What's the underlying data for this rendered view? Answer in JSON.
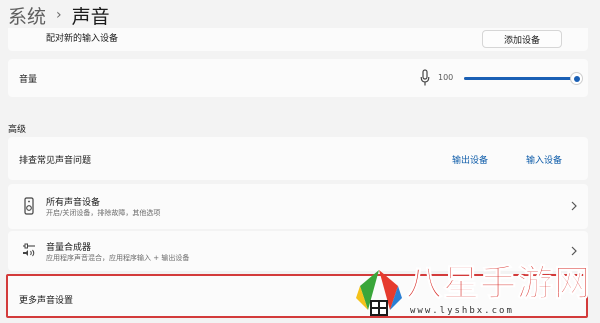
{
  "breadcrumb": {
    "parent": "系统",
    "separator": "›",
    "current": "声音"
  },
  "pair_input": {
    "label": "配对新的输入设备",
    "button": "添加设备"
  },
  "volume": {
    "label": "音量",
    "value": "100",
    "level_percent": 100
  },
  "advanced": {
    "header": "高级",
    "troubleshoot": {
      "label": "排查常见声音问题",
      "output_link": "输出设备",
      "input_link": "输入设备"
    },
    "all_devices": {
      "title": "所有声音设备",
      "desc": "开启/关闭设备，排除故障，其他选项"
    },
    "mixer": {
      "title": "音量合成器",
      "desc": "应用程序声音混合，应用程序输入 + 输出设备"
    },
    "more": {
      "title": "更多声音设置"
    }
  },
  "watermark": {
    "text": "八星手游网",
    "url": "www.lyshbx.com"
  },
  "colors": {
    "accent": "#1a5fb4",
    "link": "#0f5daa",
    "highlight_border": "#d33b3b",
    "watermark": "#d72a25"
  }
}
